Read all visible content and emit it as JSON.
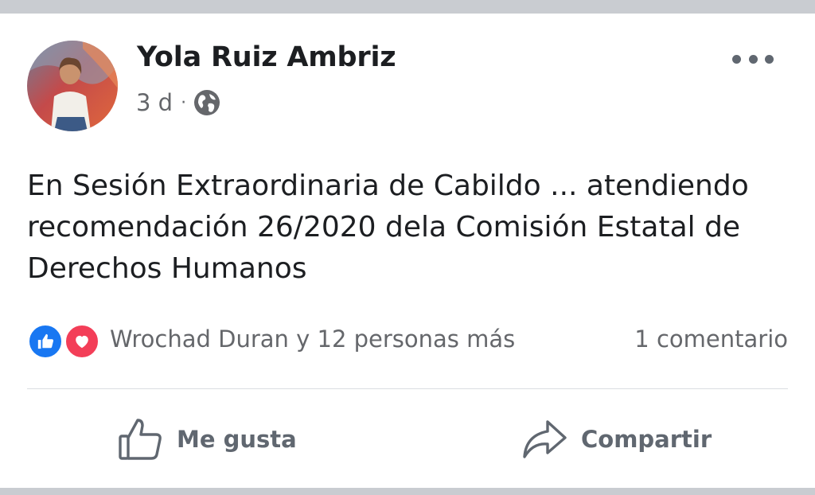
{
  "post": {
    "author": "Yola Ruiz Ambriz",
    "time": "3 d",
    "separator": "·",
    "privacy_icon": "globe-icon",
    "text": "En Sesión Extraordinaria de Cabildo ... atendiendo recomendación 26/2020 dela Comisión Estatal de Derechos Humanos"
  },
  "reactions": {
    "icons": [
      "like-reaction-icon",
      "love-reaction-icon"
    ],
    "summary": "Wrochad Duran y 12 personas más",
    "comments": "1 comentario"
  },
  "actions": {
    "like_label": "Me gusta",
    "share_label": "Compartir"
  },
  "colors": {
    "like_blue": "#1877f2",
    "love_red": "#f33e58",
    "secondary_text": "#65676b",
    "separator_band": "#c9ccd1"
  }
}
